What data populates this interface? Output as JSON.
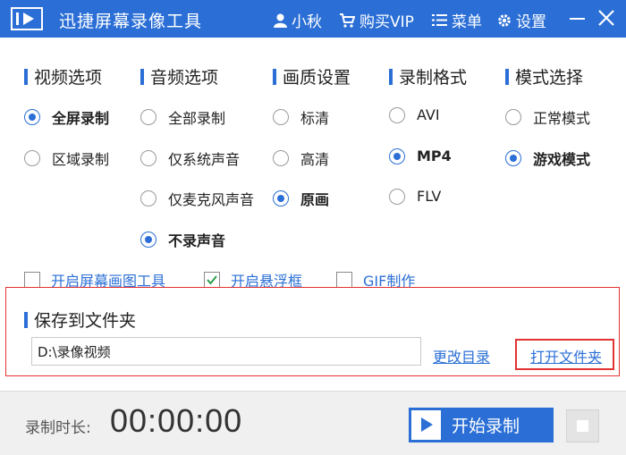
{
  "app": {
    "title": "迅捷屏幕录像工具"
  },
  "titlebar": {
    "user": "小秋",
    "buy": "购买VIP",
    "menu": "菜单",
    "settings": "设置"
  },
  "columns": {
    "video": {
      "heading": "视频选项",
      "options": [
        "全屏录制",
        "区域录制"
      ]
    },
    "audio": {
      "heading": "音频选项",
      "options": [
        "全部录制",
        "仅系统声音",
        "仅麦克风声音",
        "不录声音"
      ]
    },
    "quality": {
      "heading": "画质设置",
      "options": [
        "标清",
        "高清",
        "原画"
      ]
    },
    "format": {
      "heading": "录制格式",
      "options": [
        "AVI",
        "MP4",
        "FLV"
      ]
    },
    "mode": {
      "heading": "模式选择",
      "options": [
        "正常模式",
        "游戏模式"
      ]
    }
  },
  "checks": {
    "draw_tool": "开启屏幕画图工具",
    "float_box": "开启悬浮框",
    "gif": "GIF制作"
  },
  "save": {
    "heading": "保存到文件夹",
    "path": "D:\\录像视频",
    "change_dir": "更改目录",
    "open_folder": "打开文件夹"
  },
  "bottom": {
    "duration_label": "录制时长:",
    "duration": "00:00:00",
    "start": "开始录制"
  },
  "colors": {
    "accent": "#2b6fd6",
    "highlight_border": "#e23232"
  }
}
